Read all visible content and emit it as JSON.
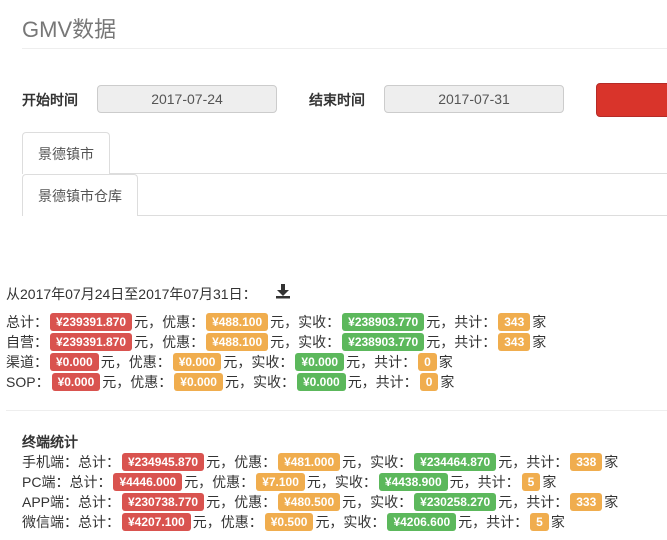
{
  "page": {
    "title": "GMV数据"
  },
  "filters": {
    "start_label": "开始时间",
    "start_value": "2017-07-24",
    "end_label": "结束时间",
    "end_value": "2017-07-31"
  },
  "colors": {
    "submit_button": "#d9342b",
    "badge_total": "#d9534f",
    "badge_discount": "#f0ad4e",
    "badge_received": "#5cb85c"
  },
  "tabs": [
    {
      "label": "景德镇市"
    },
    {
      "label": "景德镇市仓库"
    }
  ],
  "summary": {
    "range_text": "从2017年07月24日至2017年07月31日：",
    "download_icon": "download-icon",
    "rows": [
      {
        "name": "总计：",
        "total": "¥239391.870",
        "unit1": "元，优惠：",
        "discount": "¥488.100",
        "unit2": "元，实收：",
        "received": "¥238903.770",
        "unit3": "元，共计：",
        "count": "343",
        "unit4": "家"
      },
      {
        "name": "自营：",
        "total": "¥239391.870",
        "unit1": "元，优惠：",
        "discount": "¥488.100",
        "unit2": "元，实收：",
        "received": "¥238903.770",
        "unit3": "元，共计：",
        "count": "343",
        "unit4": "家"
      },
      {
        "name": "渠道：",
        "total": "¥0.000",
        "unit1": "元，优惠：",
        "discount": "¥0.000",
        "unit2": "元，实收：",
        "received": "¥0.000",
        "unit3": "元，共计：",
        "count": "0",
        "unit4": "家"
      },
      {
        "name": "SOP：",
        "total": "¥0.000",
        "unit1": "元，优惠：",
        "discount": "¥0.000",
        "unit2": "元，实收：",
        "received": "¥0.000",
        "unit3": "元，共计：",
        "count": "0",
        "unit4": "家"
      }
    ]
  },
  "terminal": {
    "title": "终端统计",
    "rows": [
      {
        "name": "手机端：总计：",
        "total": "¥234945.870",
        "unit1": "元，优惠：",
        "discount": "¥481.000",
        "unit2": "元，实收：",
        "received": "¥234464.870",
        "unit3": "元，共计：",
        "count": "338",
        "unit4": "家"
      },
      {
        "name": "PC端：总计：",
        "total": "¥4446.000",
        "unit1": "元，优惠：",
        "discount": "¥7.100",
        "unit2": "元，实收：",
        "received": "¥4438.900",
        "unit3": "元，共计：",
        "count": "5",
        "unit4": "家"
      },
      {
        "name": "APP端：总计：",
        "total": "¥230738.770",
        "unit1": "元，优惠：",
        "discount": "¥480.500",
        "unit2": "元，实收：",
        "received": "¥230258.270",
        "unit3": "元，共计：",
        "count": "333",
        "unit4": "家"
      },
      {
        "name": "微信端：总计：",
        "total": "¥4207.100",
        "unit1": "元，优惠：",
        "discount": "¥0.500",
        "unit2": "元，实收：",
        "received": "¥4206.600",
        "unit3": "元，共计：",
        "count": "5",
        "unit4": "家"
      }
    ]
  }
}
